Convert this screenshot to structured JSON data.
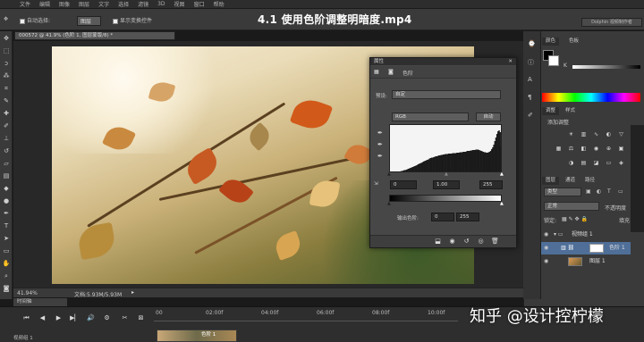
{
  "video_title": "4.1 使用色阶调整明暗度.mp4",
  "menu": [
    "文件",
    "编辑",
    "图像",
    "图层",
    "文字",
    "选择",
    "滤镜",
    "3D",
    "视图",
    "窗口",
    "帮助"
  ],
  "options_bar": {
    "auto_select_label": "自动选择:",
    "auto_select_value": "图层",
    "show_transform_label": "显示变换控件"
  },
  "workspace_label": "Dolphin 视频制作者",
  "document": {
    "tab_label": "000572 @ 41.9% (色阶 1, 图层蒙版/8) *",
    "zoom": "41.94%",
    "doc_size": "文档:5.93M/5.93M"
  },
  "timeline": {
    "tab_label": "时间轴",
    "ticks": [
      "02:00f",
      "04:00f",
      "06:00f",
      "08:00f",
      "10:00f"
    ],
    "track_label": "视频组 1",
    "clip_label": "色阶 1",
    "start_label": "00"
  },
  "properties": {
    "panel_title": "属性",
    "sub_title": "色阶",
    "preset_label": "预设:",
    "preset_value": "自定",
    "channel_value": "RGB",
    "auto_button": "自动",
    "input_black": "0",
    "input_gamma": "1.00",
    "input_white": "255",
    "output_label": "输出色阶:",
    "output_black": "0",
    "output_white": "255",
    "histogram_values": [
      1,
      1,
      1,
      2,
      2,
      2,
      3,
      3,
      4,
      4,
      5,
      5,
      6,
      7,
      7,
      8,
      9,
      10,
      11,
      12,
      13,
      14,
      15,
      16,
      17,
      18,
      20,
      21,
      22,
      23,
      24,
      26,
      27,
      28,
      29,
      30,
      31,
      33,
      34,
      35,
      35,
      36,
      37,
      38,
      38,
      39,
      40,
      40,
      41,
      41,
      42,
      42,
      43,
      43,
      43,
      44,
      44,
      44,
      44,
      45,
      45,
      45,
      45,
      46,
      46,
      46,
      47,
      47,
      47,
      48,
      48,
      48,
      49,
      50,
      50,
      50,
      51,
      51,
      52,
      52,
      52,
      53,
      53,
      53,
      52,
      51,
      50,
      49,
      48,
      47,
      47,
      46,
      46,
      47,
      48,
      50,
      54,
      58,
      64,
      72,
      80,
      88,
      94,
      96,
      92,
      60,
      36
    ]
  },
  "right_panels": {
    "color_tab": "颜色",
    "swatch_tab": "色板",
    "k_label": "K",
    "adjust_tab": "调整",
    "styles_tab": "样式",
    "add_adjustment": "添加调整",
    "layers_tab": "图层",
    "channels_tab": "通道",
    "paths_tab": "路径",
    "kind_label": "类型",
    "blend_mode": "正常",
    "opacity_label": "不透明度",
    "lock_label": "锁定:",
    "fill_label": "填充",
    "layers": [
      {
        "name": "视频组 1"
      },
      {
        "name": "色阶 1"
      },
      {
        "name": "图层 1"
      }
    ]
  },
  "watermark": "知乎 @设计控柠檬"
}
